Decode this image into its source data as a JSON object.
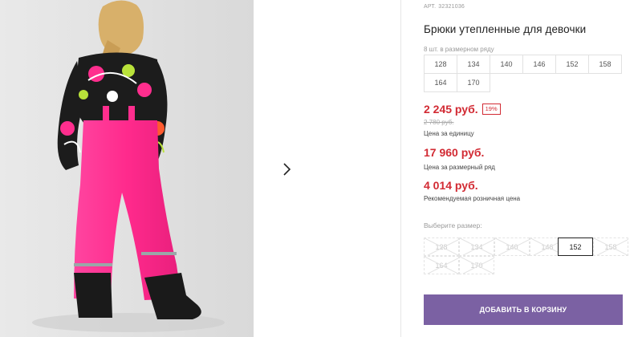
{
  "product": {
    "sku_label": "АРТ.",
    "sku": "32321036",
    "title": "Брюки утепленные для девочки",
    "pack_note": "8 шт. в размерном ряду",
    "size_range": [
      "128",
      "134",
      "140",
      "146",
      "152",
      "158",
      "164",
      "170"
    ]
  },
  "pricing": {
    "unit_price": "2 245 руб.",
    "discount": "19%",
    "old_price": "2 780 руб.",
    "unit_price_note": "Цена за единицу",
    "range_price": "17 960 руб.",
    "range_price_note": "Цена за размерный ряд",
    "retail_price": "4 014 руб.",
    "retail_price_note": "Рекомендуемая розничная цена"
  },
  "size_picker": {
    "label": "Выберите размер:",
    "selected": "152",
    "options": [
      {
        "value": "128",
        "available": false
      },
      {
        "value": "134",
        "available": false
      },
      {
        "value": "140",
        "available": false
      },
      {
        "value": "146",
        "available": false
      },
      {
        "value": "152",
        "available": true
      },
      {
        "value": "158",
        "available": false
      },
      {
        "value": "164",
        "available": false
      },
      {
        "value": "170",
        "available": false
      }
    ]
  },
  "actions": {
    "add_to_cart": "ДОБАВИТЬ В КОРЗИНУ"
  },
  "icons": {
    "next": "chevron-right-icon"
  },
  "colors": {
    "price_red": "#d22a33",
    "button_purple": "#7b61a3",
    "product_pink": "#ff2e8e"
  }
}
